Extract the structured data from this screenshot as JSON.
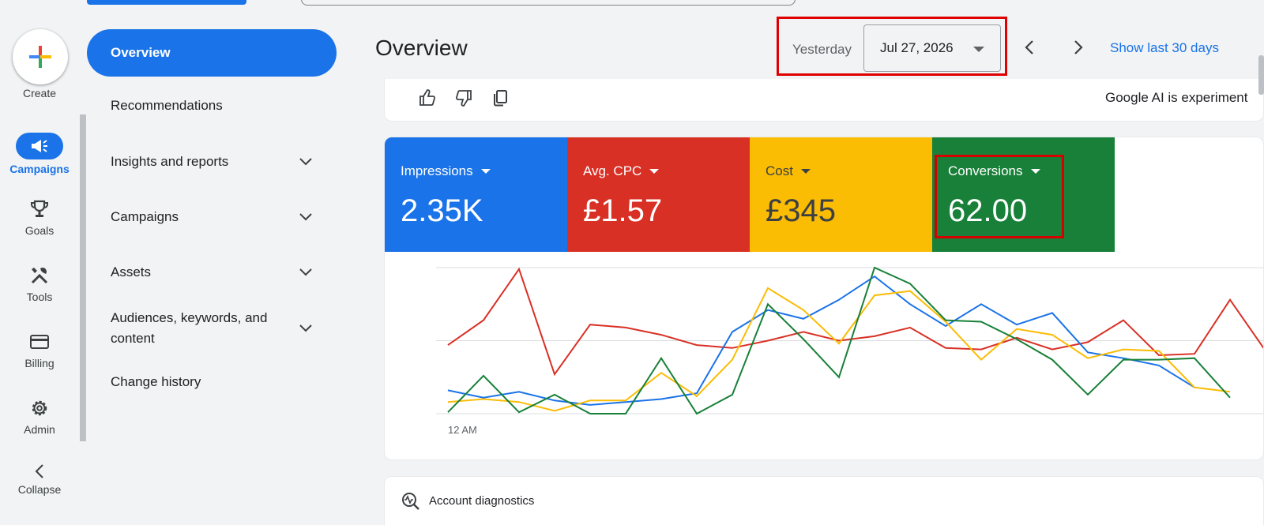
{
  "rail": {
    "create_label": "Create",
    "items": [
      {
        "label": "Campaigns",
        "icon": "megaphone-icon",
        "active": true
      },
      {
        "label": "Goals",
        "icon": "trophy-icon",
        "active": false
      },
      {
        "label": "Tools",
        "icon": "tools-icon",
        "active": false
      },
      {
        "label": "Billing",
        "icon": "credit-card-icon",
        "active": false
      },
      {
        "label": "Admin",
        "icon": "gear-icon",
        "active": false
      }
    ],
    "collapse_label": "Collapse"
  },
  "nav": {
    "overview": "Overview",
    "items": [
      {
        "label": "Recommendations",
        "expandable": false
      },
      {
        "label": "Insights and reports",
        "expandable": true
      },
      {
        "label": "Campaigns",
        "expandable": true
      },
      {
        "label": "Assets",
        "expandable": true
      },
      {
        "label_line1": "Audiences, keywords, and",
        "label_line2": "content",
        "expandable": true
      },
      {
        "label": "Change history",
        "expandable": false
      }
    ]
  },
  "header": {
    "title": "Overview",
    "date_preset": "Yesterday",
    "date_value": "Jul 27, 2026",
    "show_last_link": "Show last 30 days"
  },
  "ai_card": {
    "text": "Google AI is experiment"
  },
  "metrics": {
    "tiles": [
      {
        "label": "Impressions",
        "value": "2.35K",
        "color": "#1a73e8",
        "text_color": "#ffffff"
      },
      {
        "label": "Avg. CPC",
        "value": "£1.57",
        "color": "#d93025",
        "text_color": "#ffffff"
      },
      {
        "label": "Cost",
        "value": "£345",
        "color": "#fbbc04",
        "text_color": "#3c4043"
      },
      {
        "label": "Conversions",
        "value": "62.00",
        "color": "#188038",
        "text_color": "#ffffff"
      }
    ]
  },
  "chart_data": {
    "type": "line",
    "x_tick_labels": [
      "12 AM"
    ],
    "grid": true,
    "series": [
      {
        "color": "#d93025",
        "values": [
          0.47,
          0.64,
          0.99,
          0.27,
          0.61,
          0.59,
          0.54,
          0.47,
          0.45,
          0.5,
          0.56,
          0.5,
          0.53,
          0.59,
          0.45,
          0.44,
          0.52,
          0.44,
          0.49,
          0.64,
          0.4,
          0.41,
          0.78,
          0.43
        ]
      },
      {
        "color": "#1a73e8",
        "values": [
          0.16,
          0.11,
          0.15,
          0.09,
          0.06,
          0.08,
          0.1,
          0.14,
          0.56,
          0.71,
          0.65,
          0.78,
          0.94,
          0.75,
          0.6,
          0.75,
          0.61,
          0.69,
          0.42,
          0.38,
          0.33,
          0.18
        ]
      },
      {
        "color": "#fbbc04",
        "values": [
          0.08,
          0.1,
          0.08,
          0.02,
          0.09,
          0.09,
          0.28,
          0.12,
          0.37,
          0.86,
          0.71,
          0.48,
          0.81,
          0.84,
          0.63,
          0.37,
          0.58,
          0.54,
          0.38,
          0.44,
          0.43,
          0.18,
          0.15
        ]
      },
      {
        "color": "#188038",
        "values": [
          0.01,
          0.26,
          0.01,
          0.13,
          0.0,
          0.0,
          0.38,
          0.0,
          0.13,
          0.75,
          0.51,
          0.25,
          1.0,
          0.89,
          0.64,
          0.63,
          0.51,
          0.37,
          0.13,
          0.37,
          0.37,
          0.38,
          0.11
        ]
      }
    ]
  },
  "diagnostics": {
    "label": "Account diagnostics"
  }
}
